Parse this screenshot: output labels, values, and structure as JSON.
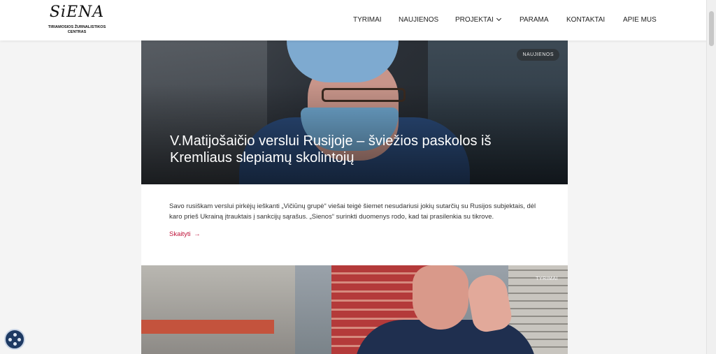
{
  "header": {
    "logo_text": "SiENA",
    "logo_subtitle": "TIRIAMOSIOS ŽURNALISTIKOS CENTRAS",
    "nav": [
      {
        "label": "TYRIMAI"
      },
      {
        "label": "NAUJIENOS"
      },
      {
        "label": "PROJEKTAI",
        "has_dropdown": true
      },
      {
        "label": "PARAMA"
      },
      {
        "label": "KONTAKTAI"
      },
      {
        "label": "APIE MUS"
      }
    ]
  },
  "articles": [
    {
      "category": "NAUJIENOS",
      "title": "V.Matijošaičio verslui Rusijoje – šviežios paskolos iš Kremliaus slepiamų skolintojų",
      "excerpt": "Savo rusiškam verslui pirkėjų ieškanti „Vičiūnų grupė“ viešai teigė šiemet nesudariusi jokių sutarčių su Rusijos subjektais, dėl karo prieš Ukrainą įtrauktais į sankcijų sąrašus. „Sienos“ surinkti duomenys rodo, kad tai prasilenkia su tikrove.",
      "read_more": "Skaityti",
      "read_more_arrow": "→"
    },
    {
      "category": "TYRIMAI"
    }
  ],
  "colors": {
    "accent": "#c0163c",
    "header_bg": "#ffffff",
    "page_bg": "#f4f4f4"
  },
  "icons": {
    "floating_widget": "accessibility-icon",
    "dropdown": "chevron-down-icon"
  }
}
